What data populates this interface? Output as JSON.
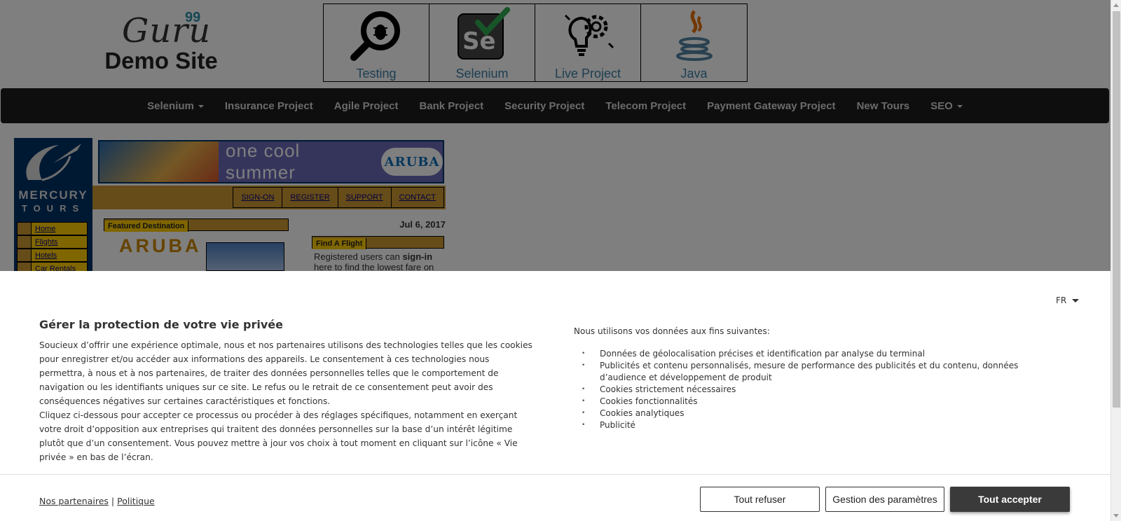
{
  "header": {
    "logo_word": "Guru",
    "logo_sup": "99",
    "logo_sub": "Demo Site",
    "tiles": [
      {
        "label": "Testing",
        "icon": "magnifier-bug-icon"
      },
      {
        "label": "Selenium",
        "icon": "selenium-icon"
      },
      {
        "label": "Live Project",
        "icon": "gear-bulb-icon"
      },
      {
        "label": "Java",
        "icon": "java-icon"
      }
    ]
  },
  "nav": {
    "items": [
      {
        "label": "Selenium",
        "dropdown": true
      },
      {
        "label": "Insurance Project"
      },
      {
        "label": "Agile Project"
      },
      {
        "label": "Bank Project"
      },
      {
        "label": "Security Project"
      },
      {
        "label": "Telecom Project"
      },
      {
        "label": "Payment Gateway Project"
      },
      {
        "label": "New Tours"
      },
      {
        "label": "SEO",
        "dropdown": true
      }
    ]
  },
  "mercury": {
    "logo_line1": "MERCURY",
    "logo_line2": "TOURS",
    "banner_text": "one cool summer",
    "banner_badge": "ARUBA",
    "top_links": [
      "SIGN-ON",
      "REGISTER",
      "SUPPORT",
      "CONTACT"
    ],
    "menu": [
      "Home",
      "Flights",
      "Hotels",
      "Car Rentals"
    ],
    "featured_title": "Featured Destination",
    "featured_name": "ARUBA",
    "date": "Jul 6, 2017",
    "find_flight_title": "Find A Flight",
    "find_flight_text_a": "Registered users can ",
    "find_flight_text_b": "sign-in",
    "find_flight_text_c": " here to find the lowest fare on"
  },
  "consent": {
    "language": "FR",
    "title": "Gérer la protection de votre vie privée",
    "body_p1": "Soucieux d’offrir une expérience optimale, nous et nos partenaires utilisons des technologies telles que les cookies pour enregistrer et/ou accéder aux informations des appareils. Le consentement à ces technologies nous permettra, à nous et à nos partenaires, de traiter des données personnelles telles que le comportement de navigation ou les identifiants uniques sur ce site. Le refus ou le retrait de ce consentement peut avoir des conséquences négatives sur certaines caractéristiques et fonctions.",
    "body_p2": "Cliquez ci-dessous pour accepter ce processus ou procéder à des réglages spécifiques, notamment en exerçant votre droit d’opposition aux entreprises qui traitent des données personnelles sur la base d’un intérêt légitime plutôt que d’un consentement. Vous pouvez mettre à jour vos choix à tout moment en cliquant sur l’icône « Vie privée » en bas de l’écran.",
    "purposes_title": "Nous utilisons vos données aux fins suivantes:",
    "purposes": [
      "Données de géolocalisation précises et identification par analyse du terminal",
      "Publicités et contenu personnalisés, mesure de performance des publicités et du contenu, données d’audience et développement de produit",
      "Cookies strictement nécessaires",
      "Cookies fonctionnalités",
      "Cookies analytiques",
      "Publicité"
    ],
    "link_partners": "Nos partenaires",
    "link_separator": "|",
    "link_policy": "Politique",
    "btn_refuse": "Tout refuser",
    "btn_settings": "Gestion des paramètres",
    "btn_accept": "Tout accepter"
  }
}
